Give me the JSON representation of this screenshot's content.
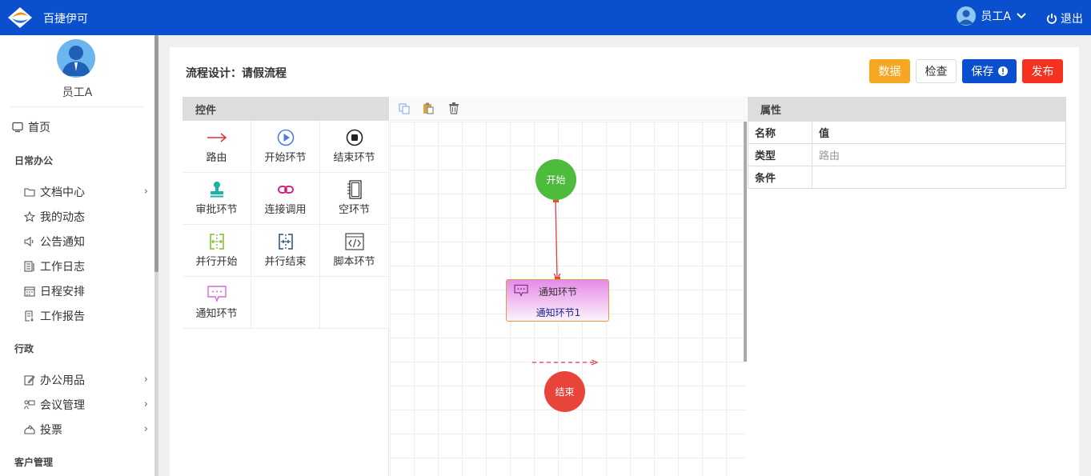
{
  "app": {
    "title": "百捷伊可"
  },
  "header": {
    "user_name": "员工A",
    "logout_label": "退出"
  },
  "sidebar": {
    "user_name": "员工A",
    "home": "首页",
    "groups": [
      {
        "title": "日常办公",
        "items": [
          "文档中心",
          "我的动态",
          "公告通知",
          "工作日志",
          "日程安排",
          "工作报告"
        ]
      },
      {
        "title": "行政",
        "items": [
          "办公用品",
          "会议管理",
          "投票"
        ]
      },
      {
        "title": "客户管理",
        "items": []
      }
    ]
  },
  "page": {
    "title": "流程设计：请假流程",
    "buttons": {
      "data": "数据",
      "check": "检查",
      "save": "保存",
      "publish": "发布"
    },
    "colors": {
      "data": "#f5a623",
      "save": "#0a4fce",
      "publish": "#f5311f"
    }
  },
  "controls": {
    "header": "控件",
    "items": [
      {
        "label": "路由",
        "icon": "arrow-right-icon"
      },
      {
        "label": "开始环节",
        "icon": "play-circle-icon"
      },
      {
        "label": "结束环节",
        "icon": "stop-circle-icon"
      },
      {
        "label": "审批环节",
        "icon": "stamp-icon"
      },
      {
        "label": "连接调用",
        "icon": "link-icon"
      },
      {
        "label": "空环节",
        "icon": "notebook-icon"
      },
      {
        "label": "并行开始",
        "icon": "parallel-start-icon"
      },
      {
        "label": "并行结束",
        "icon": "parallel-end-icon"
      },
      {
        "label": "脚本环节",
        "icon": "code-icon"
      },
      {
        "label": "通知环节",
        "icon": "message-icon"
      }
    ]
  },
  "canvas": {
    "toolbar": [
      "copy-icon",
      "paste-icon",
      "delete-icon"
    ],
    "nodes": {
      "start": "开始",
      "notify_title": "通知环节",
      "notify_name": "通知环节1",
      "end": "结束"
    }
  },
  "properties": {
    "header": "属性",
    "col_name": "名称",
    "col_value": "值",
    "rows": [
      {
        "key": "类型",
        "value": "路由"
      },
      {
        "key": "条件",
        "value": ""
      }
    ]
  }
}
